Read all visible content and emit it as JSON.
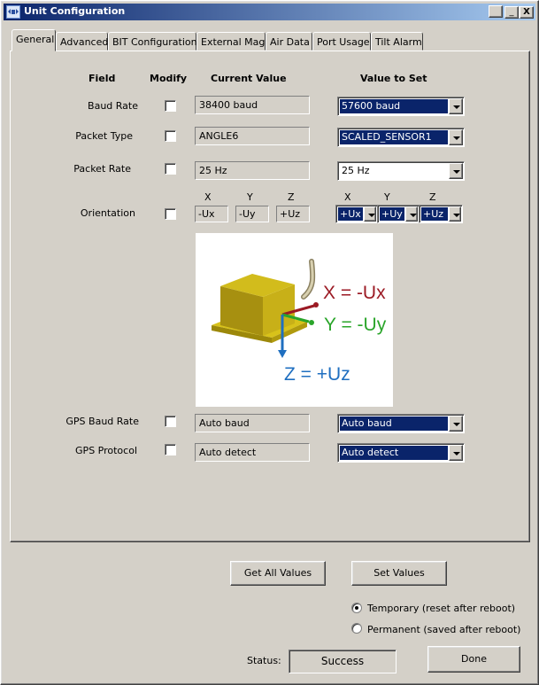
{
  "window": {
    "title": "Unit Configuration",
    "min_label": "_",
    "max_label": "□",
    "close_label": "X"
  },
  "tabs": [
    "General",
    "Advanced",
    "BIT Configuration",
    "External Mag",
    "Air Data",
    "Port Usage",
    "Tilt Alarm"
  ],
  "headers": {
    "field": "Field",
    "modify": "Modify",
    "current": "Current Value",
    "set": "Value to Set"
  },
  "rows": {
    "baud": {
      "label": "Baud Rate",
      "current": "38400 baud",
      "set": "57600 baud"
    },
    "packet_type": {
      "label": "Packet Type",
      "current": "ANGLE6",
      "set": "SCALED_SENSOR1"
    },
    "packet_rate": {
      "label": "Packet Rate",
      "current": "25 Hz",
      "set": "25 Hz"
    },
    "orientation": {
      "label": "Orientation",
      "axes": [
        "X",
        "Y",
        "Z"
      ],
      "current": [
        "-Ux",
        "-Uy",
        "+Uz"
      ],
      "set": [
        "+Ux",
        "+Uy",
        "+Uz"
      ]
    },
    "gps_baud": {
      "label": "GPS Baud Rate",
      "current": "Auto baud",
      "set": "Auto baud"
    },
    "gps_protocol": {
      "label": "GPS Protocol",
      "current": "Auto detect",
      "set": "Auto detect"
    }
  },
  "diagram": {
    "x_label": "X = -Ux",
    "y_label": "Y = -Uy",
    "z_label": "Z = +Uz",
    "colors": {
      "x": "#9b1a24",
      "y": "#2aa52a",
      "z": "#1f6fc0",
      "box": "#b9a20e"
    }
  },
  "buttons": {
    "get_all": "Get All Values",
    "set_values": "Set Values",
    "done": "Done"
  },
  "radios": {
    "temporary": "Temporary (reset after reboot)",
    "permanent": "Permanent (saved after reboot)",
    "selected": "temporary"
  },
  "status": {
    "label": "Status:",
    "value": "Success"
  }
}
